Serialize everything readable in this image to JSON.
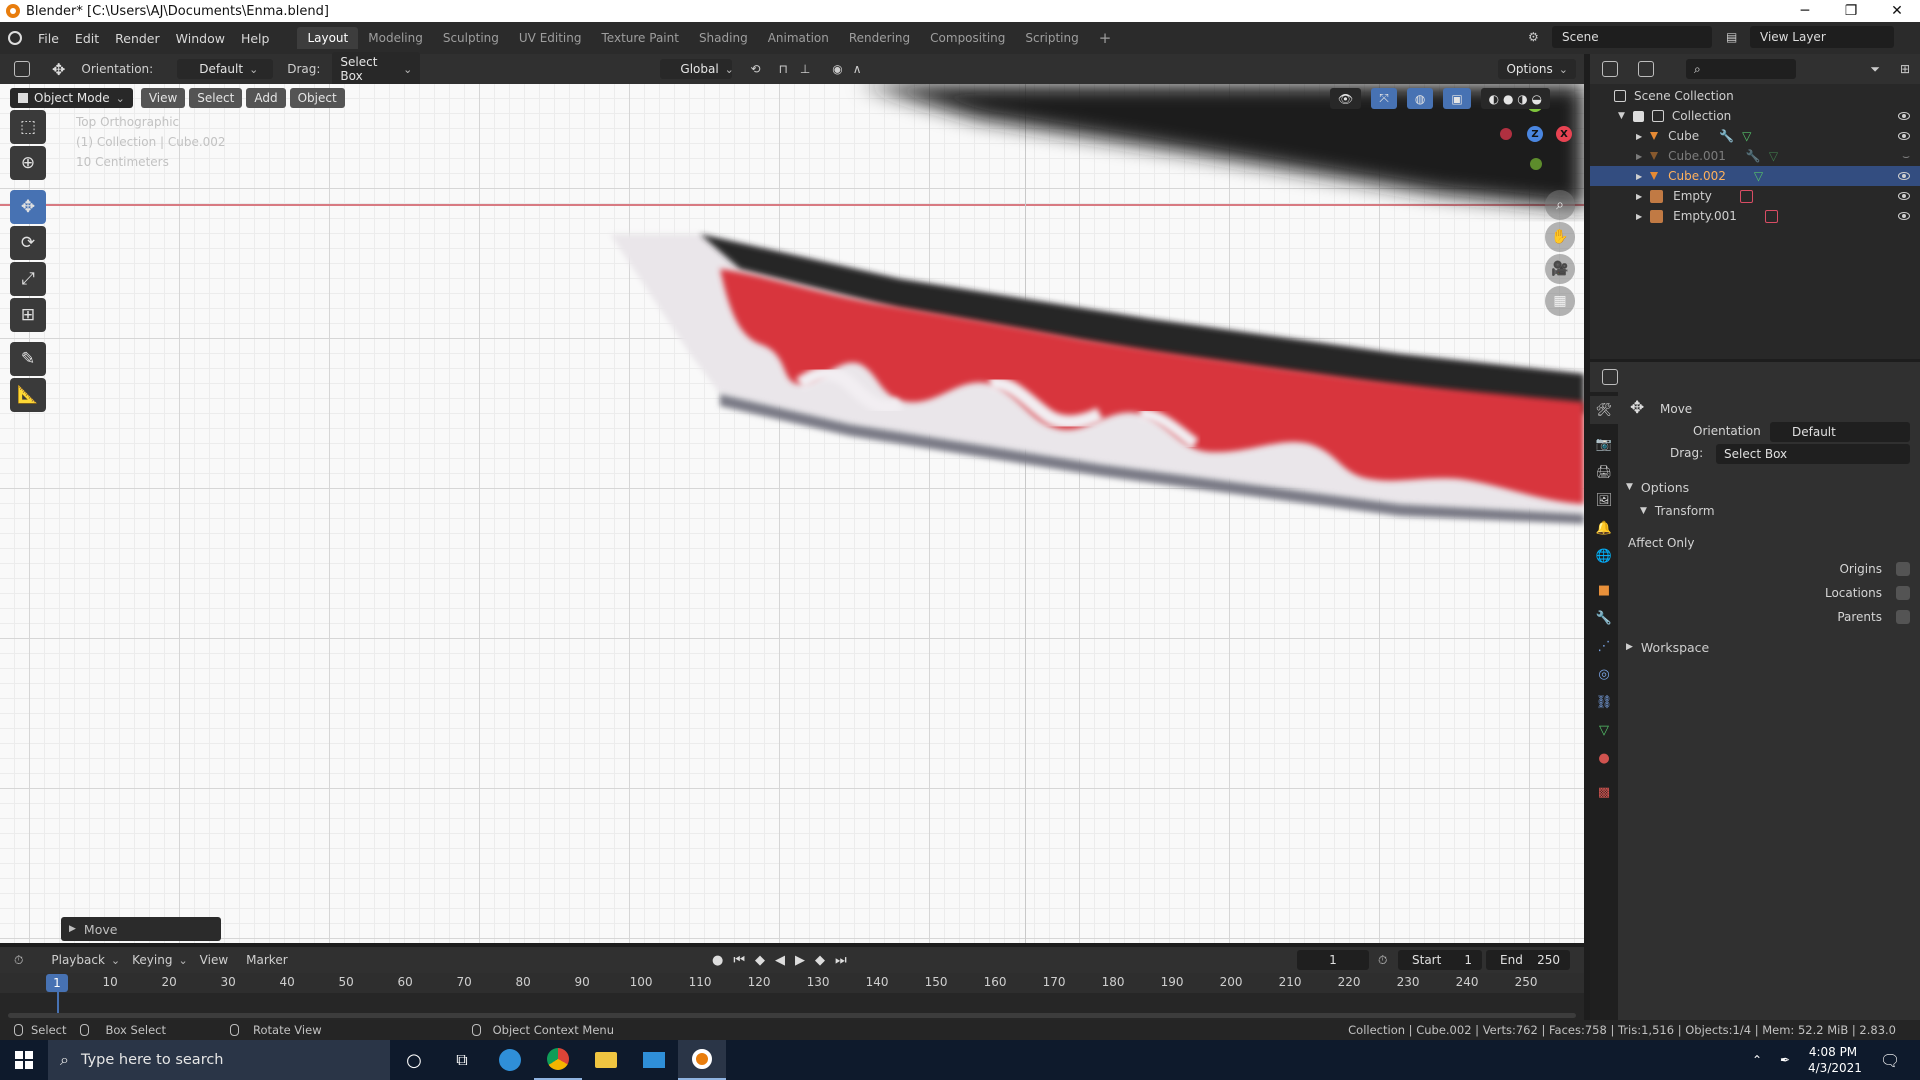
{
  "window": {
    "title": "Blender* [C:\\Users\\AJ\\Documents\\Enma.blend]",
    "controls": [
      "─",
      "❐",
      "✕"
    ]
  },
  "menu": [
    "File",
    "Edit",
    "Render",
    "Window",
    "Help"
  ],
  "workspace_tabs": [
    "Layout",
    "Modeling",
    "Sculpting",
    "UV Editing",
    "Texture Paint",
    "Shading",
    "Animation",
    "Rendering",
    "Compositing",
    "Scripting"
  ],
  "active_workspace": "Layout",
  "add_workspace": "+",
  "scene": "Scene",
  "view_layer": "View Layer",
  "tool_header": {
    "orientation_label": "Orientation:",
    "orientation_value": "Default",
    "drag_label": "Drag:",
    "drag_value": "Select Box",
    "transform_orientation": "Global",
    "options": "Options"
  },
  "viewport_header": {
    "mode": "Object Mode",
    "menus": [
      "View",
      "Select",
      "Add",
      "Object"
    ]
  },
  "viewport": {
    "info_lines": [
      "Top Orthographic",
      "(1) Collection | Cube.002",
      "10 Centimeters"
    ],
    "gizmo_axes": {
      "y": "Y",
      "z": "Z",
      "x": "X"
    },
    "last_operator": "Move"
  },
  "outliner": {
    "root": "Scene Collection",
    "collection": "Collection",
    "items": [
      {
        "name": "Cube",
        "selected": false,
        "dim": false
      },
      {
        "name": "Cube.001",
        "selected": false,
        "dim": true
      },
      {
        "name": "Cube.002",
        "selected": true,
        "dim": false
      },
      {
        "name": "Empty",
        "selected": false,
        "dim": false
      },
      {
        "name": "Empty.001",
        "selected": false,
        "dim": false
      }
    ]
  },
  "properties": {
    "tool_name": "Move",
    "orientation_label": "Orientation",
    "orientation_value": "Default",
    "drag_label": "Drag:",
    "drag_value": "Select Box",
    "options_section": "Options",
    "transform_section": "Transform",
    "affect_only": "Affect Only",
    "origins": "Origins",
    "locations": "Locations",
    "parents": "Parents",
    "workspace_section": "Workspace"
  },
  "timeline": {
    "menus": [
      "Playback",
      "Keying",
      "View",
      "Marker"
    ],
    "current_frame": "1",
    "start_label": "Start",
    "start_value": "1",
    "end_label": "End",
    "end_value": "250",
    "ruler": [
      "10",
      "20",
      "30",
      "40",
      "50",
      "60",
      "70",
      "80",
      "90",
      "100",
      "110",
      "120",
      "130",
      "140",
      "150",
      "160",
      "170",
      "180",
      "190",
      "200",
      "210",
      "220",
      "230",
      "240",
      "250"
    ],
    "playhead": "1"
  },
  "statusbar": {
    "select": "Select",
    "box_select": "Box Select",
    "rotate_view": "Rotate View",
    "context_menu": "Object Context Menu",
    "stats": "Collection | Cube.002 | Verts:762 | Faces:758 | Tris:1,516 | Objects:1/4 | Mem: 52.2 MiB | 2.83.0"
  },
  "taskbar": {
    "search_placeholder": "Type here to search",
    "time": "4:08 PM",
    "date": "4/3/2021"
  },
  "colors": {
    "accent_blue": "#4772b3",
    "blender_orange": "#e87d0d",
    "blade_red": "#d8343c"
  }
}
